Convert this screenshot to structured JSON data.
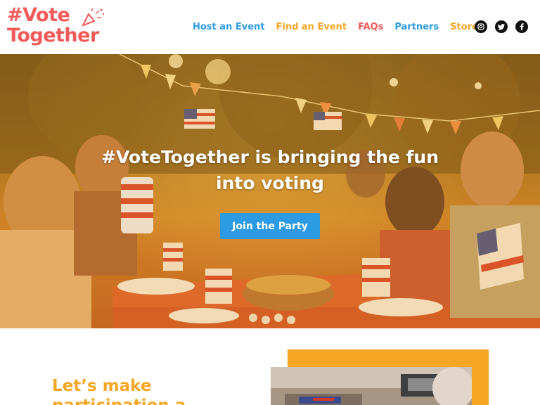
{
  "header": {
    "logo_line1": "#Vote",
    "logo_line2": "Together",
    "nav": [
      {
        "label": "Host an Event",
        "color": "#2d9be3"
      },
      {
        "label": "Find an Event",
        "color": "#f5a623"
      },
      {
        "label": "FAQs",
        "color": "#f25a5a"
      },
      {
        "label": "Partners",
        "color": "#2d9be3"
      },
      {
        "label": "Store",
        "color": "#f5a623"
      }
    ],
    "social": [
      {
        "icon": "instagram-icon",
        "glyph": "◎"
      },
      {
        "icon": "twitter-icon",
        "glyph": "🐦"
      },
      {
        "icon": "facebook-icon",
        "glyph": "f"
      }
    ]
  },
  "hero": {
    "title": "#VoteTogether is bringing the fun into voting",
    "button_label": "Join the Party"
  },
  "lower": {
    "title": "Let’s make participation a"
  },
  "colors": {
    "brand_red": "#f25a5a",
    "brand_orange": "#f5a623",
    "brand_blue": "#2d9be3"
  }
}
